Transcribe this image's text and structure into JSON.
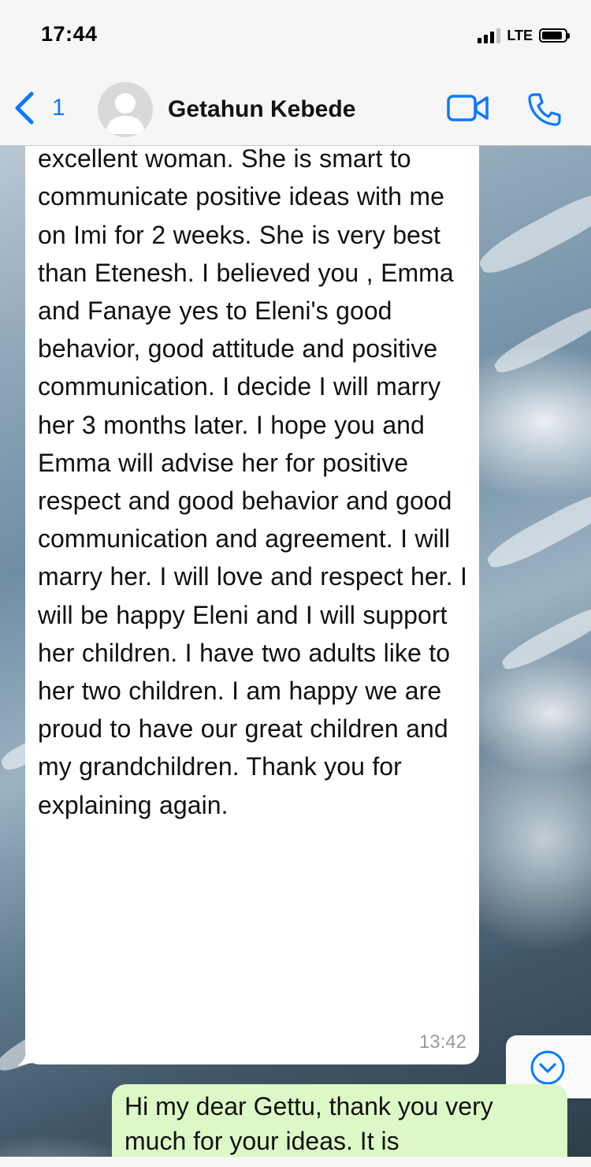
{
  "status_bar": {
    "time": "17:44",
    "network": "LTE",
    "signal_bars_on": 3,
    "signal_bars_total": 4
  },
  "header": {
    "back_count": "1",
    "contact_name": "Getahun Kebede",
    "icons": {
      "back": "chevron-left-icon",
      "avatar": "person-icon",
      "video": "video-camera-icon",
      "call": "phone-icon"
    },
    "accent_color": "#0a7aff"
  },
  "messages": [
    {
      "direction": "incoming",
      "text": "manage her own senses. She is a excellent woman. She is smart to communicate positive ideas with me on Imi for 2 weeks. She is very best than Etenesh. I believed you , Emma and Fanaye yes to Eleni's good behavior, good attitude and positive communication. I decide I will marry her 3 months later. I hope you and Emma will advise her for positive respect and good behavior and good communication and agreement. I will marry her. I will love and respect her. I will be happy Eleni and I will support her children. I have two adults like to her two children. I am happy we are proud to have our great children and my grandchildren. Thank you for explaining again.",
      "time": "13:42"
    },
    {
      "direction": "outgoing",
      "text": "Hi my dear Gettu, thank you very much for your ideas. It is"
    }
  ],
  "scroll_down_icon": "chevron-down-circle-icon",
  "colors": {
    "incoming_bubble": "#ffffff",
    "outgoing_bubble": "#dcf8c6",
    "header_bg": "#f6f6f6"
  }
}
